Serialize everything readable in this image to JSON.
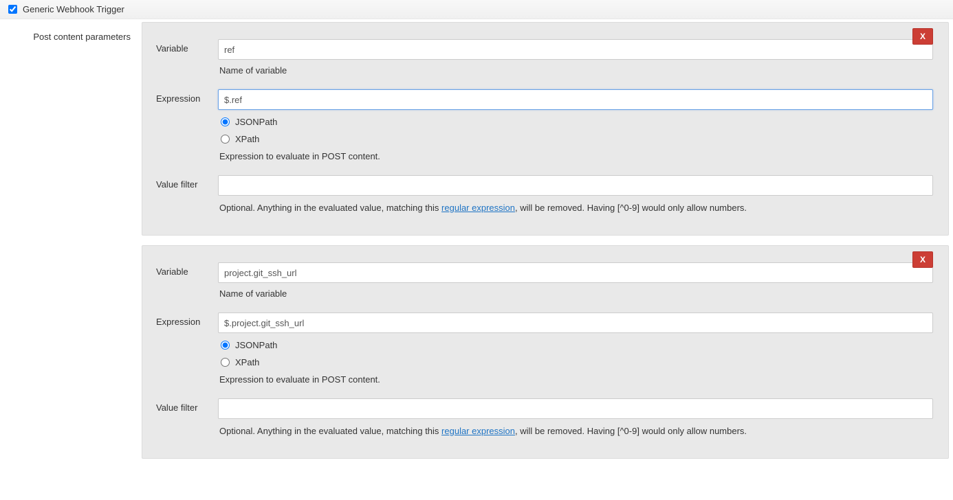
{
  "header": {
    "checked": true,
    "title": "Generic Webhook Trigger"
  },
  "sidebar_label": "Post content parameters",
  "labels": {
    "variable": "Variable",
    "expression": "Expression",
    "value_filter": "Value filter",
    "variable_help": "Name of variable",
    "expression_help": "Expression to evaluate in POST content.",
    "value_filter_help_pre": "Optional. Anything in the evaluated value, matching this ",
    "value_filter_help_link": "regular expression",
    "value_filter_help_post": ", will be removed. Having [^0-9] would only allow numbers.",
    "jsonpath": "JSONPath",
    "xpath": "XPath",
    "close": "X"
  },
  "panels": [
    {
      "variable_value": "ref",
      "expression_value": "$.ref",
      "expression_focused": true,
      "expr_type": "jsonpath",
      "value_filter_value": ""
    },
    {
      "variable_value": "project.git_ssh_url",
      "expression_value": "$.project.git_ssh_url",
      "expression_focused": false,
      "expr_type": "jsonpath",
      "value_filter_value": ""
    }
  ]
}
